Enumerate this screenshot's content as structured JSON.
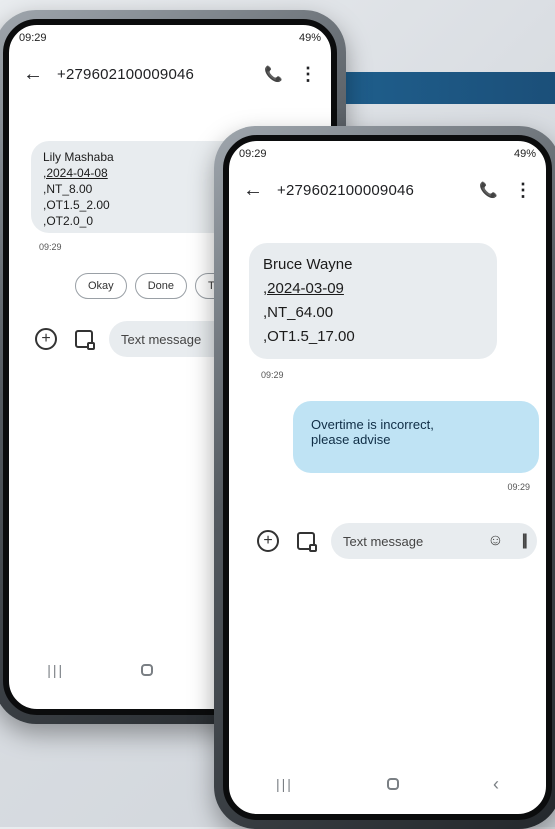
{
  "phone_back": {
    "status": {
      "time": "09:29",
      "right": "49%"
    },
    "header": {
      "back_icon": "arrow-left",
      "title": "+279602100009046",
      "call_icon": "phone",
      "menu_icon": "more-vert"
    },
    "message": {
      "lines": [
        "Lily Mashaba",
        ",2024-04-08",
        ",NT_8.00",
        ",OT1.5_2.00",
        ",OT2.0_0"
      ],
      "time": "09:29"
    },
    "chips": [
      "Okay",
      "Done",
      "Th"
    ],
    "composer": {
      "add_icon": "plus-circle",
      "gallery_icon": "gallery",
      "placeholder": "Text message"
    },
    "nav": {
      "recent_icon": "recent",
      "home_icon": "home"
    }
  },
  "phone_front": {
    "status": {
      "time": "09:29",
      "right": "49%"
    },
    "header": {
      "back_icon": "arrow-left",
      "title": "+279602100009046",
      "call_icon": "phone",
      "menu_icon": "more-vert"
    },
    "message_in": {
      "lines": [
        "Bruce Wayne",
        ",2024-03-09",
        ",NT_64.00",
        ",OT1.5_17.00"
      ],
      "time": "09:29"
    },
    "message_out": {
      "text": "Overtime is incorrect,\nplease advise",
      "time": "09:29"
    },
    "composer": {
      "add_icon": "plus-circle",
      "gallery_icon": "gallery",
      "placeholder": "Text message",
      "emoji_icon": "emoji",
      "voice_icon": "voice"
    },
    "nav": {
      "recent_icon": "recent",
      "home_icon": "home",
      "back_icon": "back"
    }
  },
  "colors": {
    "band": "#1f5f8d",
    "bubble_in": "#e8ecef",
    "bubble_out": "#bfe3f4"
  }
}
